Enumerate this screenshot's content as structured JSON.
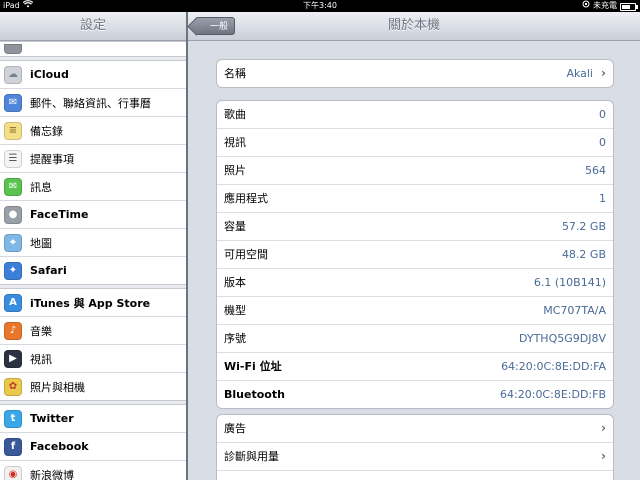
{
  "status_bar": {
    "device": "iPad",
    "time": "下午3:40",
    "charge_status": "未充電",
    "battery_level": 0.7
  },
  "sidebar": {
    "title": "設定",
    "groups": [
      {
        "items": [
          {
            "label": "",
            "icon": "general-icon",
            "color": "#8e939c",
            "cut": true
          }
        ]
      },
      {
        "items": [
          {
            "label": "iCloud",
            "icon": "cloud-icon",
            "color": "#cfd3d9",
            "bold": true
          },
          {
            "label": "郵件、聯絡資訊、行事曆",
            "icon": "mail-icon",
            "color": "#4f86d9"
          },
          {
            "label": "備忘錄",
            "icon": "notes-icon",
            "color": "#f5e08a"
          },
          {
            "label": "提醒事項",
            "icon": "reminders-icon",
            "color": "#f4f4f4"
          },
          {
            "label": "訊息",
            "icon": "messages-icon",
            "color": "#5ac24f"
          },
          {
            "label": "FaceTime",
            "icon": "facetime-icon",
            "color": "#9aa0a8",
            "bold": true
          },
          {
            "label": "地圖",
            "icon": "maps-icon",
            "color": "#7fb7e6"
          },
          {
            "label": "Safari",
            "icon": "compass-icon",
            "color": "#3b7fd8",
            "bold": true
          }
        ]
      },
      {
        "items": [
          {
            "label": "iTunes 與 App Store",
            "icon": "appstore-icon",
            "color": "#3a8ee0",
            "bold": true
          },
          {
            "label": "音樂",
            "icon": "music-icon",
            "color": "#e8762b"
          },
          {
            "label": "視訊",
            "icon": "video-icon",
            "color": "#2c3340"
          },
          {
            "label": "照片與相機",
            "icon": "photos-icon",
            "color": "#e9c84a"
          }
        ]
      },
      {
        "items": [
          {
            "label": "Twitter",
            "icon": "twitter-icon",
            "color": "#3aa8e8",
            "bold": true
          },
          {
            "label": "Facebook",
            "icon": "facebook-icon",
            "color": "#3b5998",
            "bold": true
          },
          {
            "label": "新浪微博",
            "icon": "weibo-icon",
            "color": "#f1f1f1"
          }
        ]
      }
    ]
  },
  "detail": {
    "title": "關於本機",
    "back_label": "一般",
    "groups": [
      {
        "rows": [
          {
            "label": "名稱",
            "value": "Akali",
            "chevron": true
          }
        ]
      },
      {
        "rows": [
          {
            "label": "歌曲",
            "value": "0"
          },
          {
            "label": "視訊",
            "value": "0"
          },
          {
            "label": "照片",
            "value": "564"
          },
          {
            "label": "應用程式",
            "value": "1"
          },
          {
            "label": "容量",
            "value": "57.2 GB"
          },
          {
            "label": "可用空間",
            "value": "48.2 GB"
          },
          {
            "label": "版本",
            "value": "6.1 (10B141)"
          },
          {
            "label": "機型",
            "value": "MC707TA/A"
          },
          {
            "label": "序號",
            "value": "DYTHQ5G9DJ8V"
          },
          {
            "label": "Wi-Fi 位址",
            "value": "64:20:0C:8E:DD:FA",
            "bold": true
          },
          {
            "label": "Bluetooth",
            "value": "64:20:0C:8E:DD:FB",
            "bold": true
          }
        ]
      },
      {
        "rows": [
          {
            "label": "廣告",
            "value": "",
            "chevron": true
          },
          {
            "label": "診斷與用量",
            "value": "",
            "chevron": true
          },
          {
            "label": "",
            "value": "",
            "chevron": false
          }
        ]
      }
    ]
  }
}
